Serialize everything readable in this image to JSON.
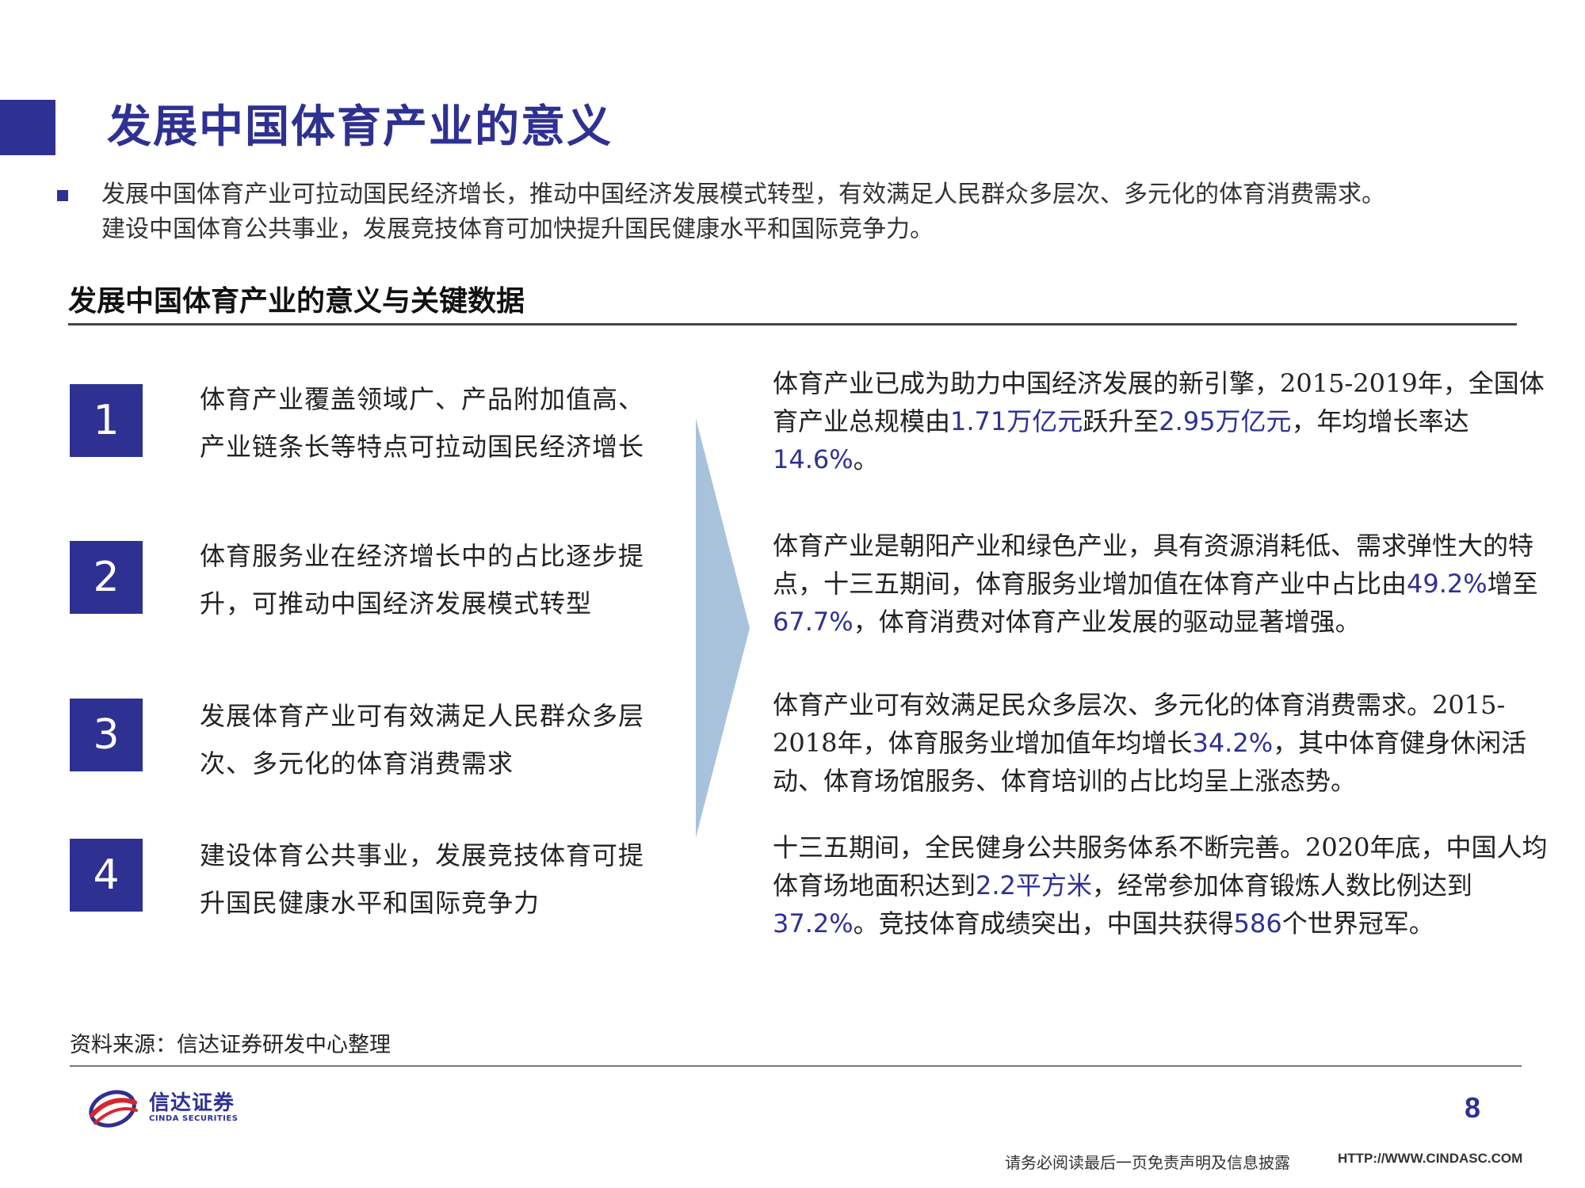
{
  "title": "发展中国体育产业的意义",
  "intro": {
    "line1": "发展中国体育产业可拉动国民经济增长，推动中国经济发展模式转型，有效满足人民群众多层次、多元化的体育消费需求。",
    "line2": "建设中国体育公共事业，发展竞技体育可加快提升国民健康水平和国际竞争力。"
  },
  "section_title": "发展中国体育产业的意义与关键数据",
  "points": [
    {
      "number": "1",
      "line1": "体育产业覆盖领域广、产品附加值高、",
      "line2": "产业链条长等特点可拉动国民经济增长"
    },
    {
      "number": "2",
      "line1": "体育服务业在经济增长中的占比逐步提",
      "line2": "升，可推动中国经济发展模式转型"
    },
    {
      "number": "3",
      "line1": "发展体育产业可有效满足人民群众多层",
      "line2": "次、多元化的体育消费需求"
    },
    {
      "number": "4",
      "line1": "建设体育公共事业，发展竞技体育可提",
      "line2": "升国民健康水平和国际竞争力"
    }
  ],
  "details": [
    [
      {
        "t": "体育产业已成为助力中国经济发展的新引擎，2015-2019年，全国体育产业总规模由"
      },
      {
        "t": "1.71万亿元",
        "h": true
      },
      {
        "t": "跃升至"
      },
      {
        "t": "2.95万亿元",
        "h": true
      },
      {
        "t": "，年均增长率达"
      },
      {
        "t": "14.6%",
        "h": true
      },
      {
        "t": "。"
      }
    ],
    [
      {
        "t": "体育产业是朝阳产业和绿色产业，具有资源消耗低、需求弹性大的特点，十三五期间，体育服务业增加值在体育产业中占比由"
      },
      {
        "t": "49.2%",
        "h": true
      },
      {
        "t": "增至"
      },
      {
        "t": "67.7%",
        "h": true
      },
      {
        "t": "，体育消费对体育产业发展的驱动显著增强。"
      }
    ],
    [
      {
        "t": "体育产业可有效满足民众多层次、多元化的体育消费需求。2015-2018年，体育服务业增加值年均增长"
      },
      {
        "t": "34.2%",
        "h": true
      },
      {
        "t": "，其中体育健身休闲活动、体育场馆服务、体育培训的占比均呈上涨态势。"
      }
    ],
    [
      {
        "t": "十三五期间，全民健身公共服务体系不断完善。2020年底，中国人均体育场地面积达到"
      },
      {
        "t": "2.2平方米",
        "h": true
      },
      {
        "t": "，经常参加体育锻炼人数比例达到"
      },
      {
        "t": "37.2%",
        "h": true
      },
      {
        "t": "。竞技体育成绩突出，中国共获得"
      },
      {
        "t": "586",
        "h": true
      },
      {
        "t": "个世界冠军。"
      }
    ]
  ],
  "source": "资料来源：信达证券研发中心整理",
  "logo": {
    "name_cn": "信达证券",
    "name_en": "CINDA SECURITIES"
  },
  "page_number": "8",
  "footer": {
    "disclaimer": "请务必阅读最后一页免责声明及信息披露",
    "website": "HTTP://WWW.CINDASC.COM"
  },
  "colors": {
    "brand": "#2e3192",
    "arrow": "#a9c2dc",
    "logo_red": "#d7262e"
  }
}
